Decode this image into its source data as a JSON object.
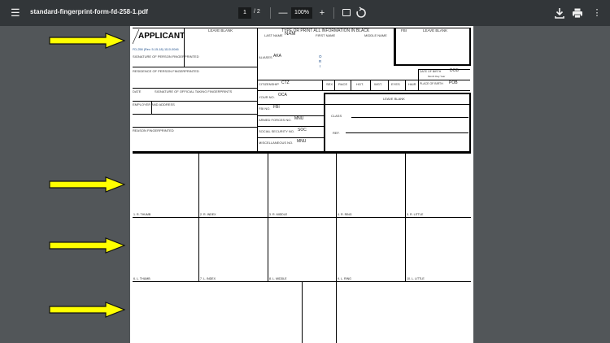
{
  "toolbar": {
    "file_name": "standard-fingerprint-form-fd-258-1.pdf",
    "page_current": "1",
    "page_total": "/ 2",
    "zoom": "100%",
    "minus": "—",
    "plus": "+"
  },
  "form": {
    "applicant": "APPLICANT",
    "form_number": "FD-258 (Rev. 5-15-18) 1110-0046",
    "signature_label": "SIGNATURE OF PERSON FINGERPRINTED",
    "residence_label": "RESIDENCE OF PERSON FINGERPRINTED",
    "date_label": "DATE",
    "official_sig_label": "SIGNATURE OF OFFICIAL TAKING FINGERPRINTS",
    "employer_label": "EMPLOYER AND ADDRESS",
    "reason_label": "REASON FINGERPRINTED",
    "leave_blank_1": "LEAVE BLANK",
    "type_print": "TYPE OR PRINT ALL INFORMATION IN BLACK",
    "last_name": "LAST NAME",
    "nam": "NAM",
    "first_name": "FIRST NAME",
    "middle_name": "MIDDLE NAME",
    "fbi_label": "FBI",
    "leave_blank_2": "LEAVE BLANK",
    "aliases_label": "ALIASES",
    "aka": "AKA",
    "ori_o": "O",
    "ori_r": "R",
    "ori_i": "I",
    "dob_label": "DATE OF BIRTH",
    "dob": "DOB",
    "dob_sub": "Month    Day    Year",
    "citizenship_label": "CITIZENSHIP",
    "ctz": "CTZ",
    "sex": "SEX",
    "race": "RACE",
    "hgt": "HGT.",
    "wgt": "WGT.",
    "eyes": "EYES",
    "hair": "HAIR",
    "pob_label": "PLACE OF BIRTH",
    "pob": "POB",
    "your_no_label": "YOUR NO.",
    "oca": "OCA",
    "leave_blank_3": "LEAVE BLANK",
    "fbi_no_label": "FBI NO.",
    "fbi": "FBI",
    "class_label": "CLASS",
    "armed_forces_label": "ARMED FORCES NO.",
    "mnu_1": "MNU",
    "ref_label": "REF.",
    "ssn_label": "SOCIAL SECURITY NO.",
    "soc": "SOC",
    "misc_label": "MISCELLANEOUS NO.",
    "mnu_2": "MNU"
  },
  "fingerprints": {
    "row1": [
      "1. R. THUMB",
      "2. R. INDEX",
      "3. R. MIDDLE",
      "4. R. RING",
      "5. R. LITTLE"
    ],
    "row2": [
      "6. L. THUMB",
      "7. L. INDEX",
      "8. L. MIDDLE",
      "9. L. RING",
      "10. L. LITTLE"
    ]
  },
  "colors": {
    "arrow_fill": "#ffff00",
    "toolbar_bg": "#323639",
    "viewer_bg": "#525659"
  }
}
